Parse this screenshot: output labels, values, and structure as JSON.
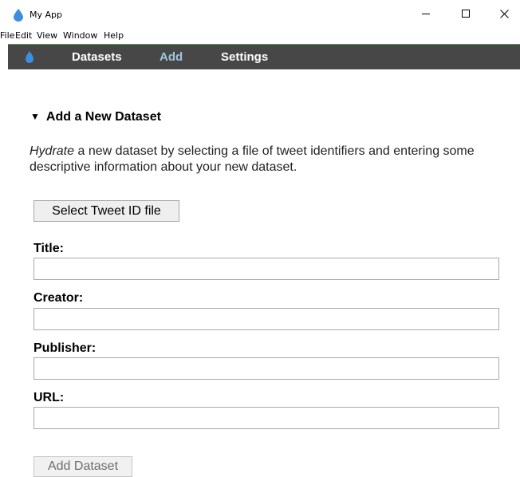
{
  "window": {
    "title": "My App",
    "controls": [
      "minimize-icon",
      "maximize-icon",
      "close-icon"
    ]
  },
  "menubar": {
    "items": [
      "File",
      "Edit",
      "View",
      "Window",
      "Help"
    ]
  },
  "nav": {
    "logo_icon": "water-drop-icon",
    "items": [
      {
        "label": "Datasets",
        "active": false
      },
      {
        "label": "Add",
        "active": true
      },
      {
        "label": "Settings",
        "active": false
      }
    ]
  },
  "section": {
    "toggle_icon": "triangle-down-icon",
    "title": "Add a New Dataset",
    "desc_em": "Hydrate",
    "desc_rest": " a new dataset by selecting a file of tweet identifiers and entering some descriptive information about your new dataset."
  },
  "select_file_button": "Select Tweet ID file",
  "fields": [
    {
      "label": "Title:",
      "value": "",
      "placeholder": ""
    },
    {
      "label": "Creator:",
      "value": "",
      "placeholder": ""
    },
    {
      "label": "Publisher:",
      "value": "",
      "placeholder": ""
    },
    {
      "label": "URL:",
      "value": "",
      "placeholder": ""
    }
  ],
  "add_dataset_button": "Add Dataset",
  "colors": {
    "navbar_bg": "#474747",
    "nav_active": "#9fc5e0",
    "accent_drop": "#3a8fe0",
    "navbar_border": "#5a9b52"
  }
}
